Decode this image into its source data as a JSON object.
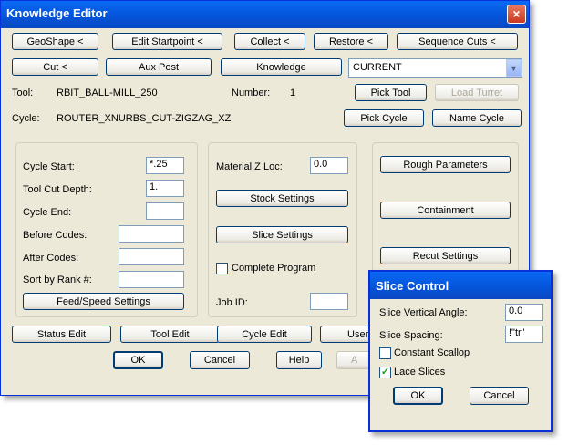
{
  "main": {
    "title": "Knowledge Editor",
    "close_glyph": "×",
    "buttons_row1": [
      "GeoShape <",
      "Edit Startpoint <",
      "Collect <",
      "Restore <",
      "Sequence Cuts <"
    ],
    "buttons_row2": [
      "Cut <",
      "Aux Post",
      "Knowledge"
    ],
    "dropdown_value": "CURRENT",
    "tool_label": "Tool:",
    "tool_value": "RBIT_BALL-MILL_250",
    "number_label": "Number:",
    "number_value": "1",
    "pick_tool": "Pick Tool",
    "load_turret": "Load Turret",
    "cycle_label": "Cycle:",
    "cycle_value": "ROUTER_XNURBS_CUT-ZIGZAG_XZ",
    "pick_cycle": "Pick Cycle",
    "name_cycle": "Name Cycle",
    "left_group": {
      "cycle_start_label": "Cycle Start:",
      "cycle_start_value": "*.25",
      "tool_cut_depth_label": "Tool Cut Depth:",
      "tool_cut_depth_value": "1.",
      "cycle_end_label": "Cycle End:",
      "cycle_end_value": "",
      "before_codes_label": "Before Codes:",
      "before_codes_value": "",
      "after_codes_label": "After Codes:",
      "after_codes_value": "",
      "sort_by_rank_label": "Sort by Rank #:",
      "sort_by_rank_value": "",
      "feed_speed_button": "Feed/Speed Settings"
    },
    "middle_group": {
      "material_z_label": "Material Z Loc:",
      "material_z_value": "0.0",
      "stock_settings": "Stock Settings",
      "slice_settings": "Slice Settings",
      "complete_program_label": "Complete Program",
      "complete_program_checked": false,
      "job_id_label": "Job ID:",
      "job_id_value": ""
    },
    "right_group": {
      "rough_parameters": "Rough Parameters",
      "containment": "Containment",
      "recut_settings": "Recut Settings"
    },
    "bottom_row": [
      "Status Edit",
      "Tool Edit",
      "Cycle Edit",
      "User"
    ],
    "ok": "OK",
    "cancel": "Cancel",
    "help": "Help",
    "apply_partial": "A"
  },
  "slice": {
    "title": "Slice Control",
    "vertical_angle_label": "Slice Vertical Angle:",
    "vertical_angle_value": "0.0",
    "spacing_label": "Slice Spacing:",
    "spacing_value": "!\"tr\"",
    "constant_scallop_label": "Constant Scallop",
    "constant_scallop_checked": false,
    "lace_slices_label": "Lace Slices",
    "lace_slices_checked": true,
    "ok": "OK",
    "cancel": "Cancel"
  },
  "colors": {
    "titlebar": "#0453d8",
    "dialog_bg": "#ece9d8",
    "close_button": "#c9381e",
    "check_mark": "#21a121"
  }
}
